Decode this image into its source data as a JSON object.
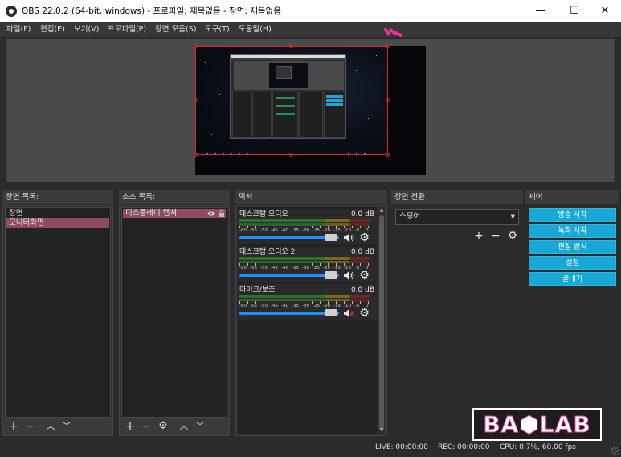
{
  "window": {
    "title": "OBS 22.0.2 (64-bit, windows) - 프로파일: 제목없음 - 장면: 제목없음",
    "minimize": "—",
    "maximize": "☐",
    "close": "✕"
  },
  "menu": [
    "파일(F)",
    "편집(E)",
    "보기(V)",
    "프로파일(P)",
    "장면 모음(S)",
    "도구(T)",
    "도움말(H)"
  ],
  "scenes": {
    "title": "장면 목록:",
    "items": [
      "장면",
      "모니터화면"
    ],
    "selected_index": 1
  },
  "sources": {
    "title": "소스 목록:",
    "items": [
      "디스플레이 캡쳐"
    ]
  },
  "mixer": {
    "title": "믹서",
    "channels": [
      {
        "name": "데스크탑 오디오",
        "db": "0.0 dB",
        "muted": false
      },
      {
        "name": "데스크탑 오디오 2",
        "db": "0.0 dB",
        "muted": false
      },
      {
        "name": "마이크/보조",
        "db": "0.0 dB",
        "muted": true
      }
    ],
    "scale": [
      "-60",
      "-55",
      "-50",
      "-45",
      "-40",
      "-35",
      "-30",
      "-25",
      "-20",
      "-15",
      "-10",
      "-5",
      "0"
    ]
  },
  "transitions": {
    "title": "장면 전환",
    "selected": "스팅어"
  },
  "controls": {
    "title": "제어",
    "buttons": [
      "방송 시작",
      "녹화 시작",
      "편집 방식",
      "설정",
      "끝내기"
    ]
  },
  "status": {
    "live": "LIVE: 00:00:00",
    "rec": "REC: 00:00:00",
    "cpu": "CPU: 0.7%, 60.00 fps"
  },
  "watermark": "BA⬢LAB",
  "colors": {
    "selection": "#8d4b63",
    "button": "#19a8d6",
    "preview_border": "#d62828",
    "mark": "#e4359b"
  }
}
